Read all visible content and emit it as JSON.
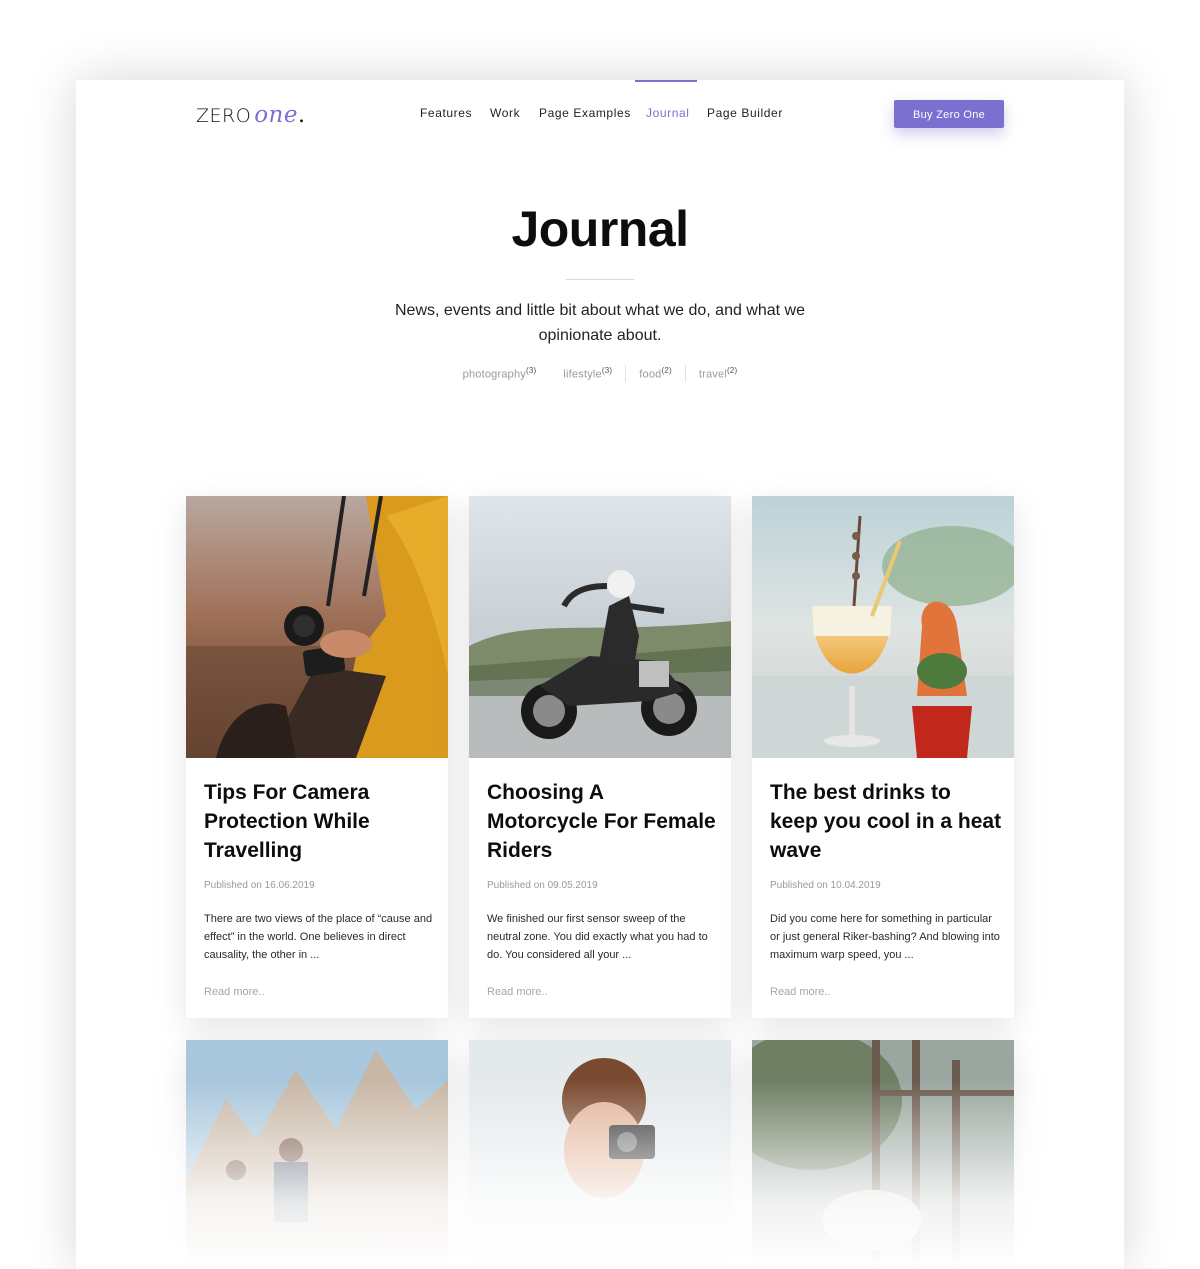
{
  "brand": {
    "logo_zero": "ZERO",
    "logo_one": "one",
    "logo_dot": "."
  },
  "nav": {
    "items": [
      {
        "label": "Features"
      },
      {
        "label": "Work"
      },
      {
        "label": "Page Examples"
      },
      {
        "label": "Journal"
      },
      {
        "label": "Page Builder"
      }
    ],
    "active": "Journal",
    "cta_label": "Buy Zero One"
  },
  "hero": {
    "title": "Journal",
    "subtitle": "News, events and little bit about what we do, and what we opinionate about."
  },
  "tags": [
    {
      "label": "photography",
      "count": "(3)"
    },
    {
      "label": "lifestyle",
      "count": "(3)"
    },
    {
      "label": "food",
      "count": "(2)"
    },
    {
      "label": "travel",
      "count": "(2)"
    }
  ],
  "posts": [
    {
      "title": "Tips For Camera Protection While Travelling",
      "date": "Published on 16.06.2019",
      "excerpt": "There are two views of the place of “cause and effect” in the world. One believes in direct causality, the other in ...",
      "read_more": "Read more.."
    },
    {
      "title": "Choosing A Motorcycle For Female Riders",
      "date": "Published on 09.05.2019",
      "excerpt": "We finished our first sensor sweep of the neutral zone. You did exactly what you had to do. You considered all your ...",
      "read_more": "Read more.."
    },
    {
      "title": "The best drinks to keep you cool in a heat wave",
      "date": "Published on 10.04.2019",
      "excerpt": "Did you come here for something in particular or just general Riker-bashing? And blowing into maximum warp speed, you ...",
      "read_more": "Read more.."
    }
  ],
  "colors": {
    "accent": "#7b6fcf",
    "text": "#111111",
    "muted": "#9a9a9a"
  }
}
